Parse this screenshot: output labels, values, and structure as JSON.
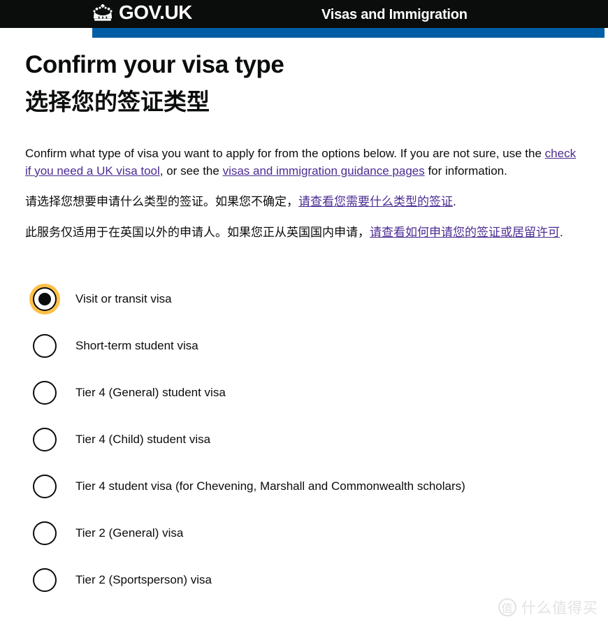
{
  "header": {
    "brand_label": "GOV.UK",
    "crown_icon": "crown-icon",
    "service_name": "Visas and Immigration",
    "background_color": "#0b0c0c",
    "accent_bar_color": "#005ea5"
  },
  "main": {
    "title_en": "Confirm your visa type",
    "title_cn": "选择您的签证类型",
    "paragraph_en": {
      "part1": "Confirm what type of visa you want to apply for from the options below. If you are not sure, use the ",
      "link1": "check if you need a UK visa tool",
      "part2": ", or see the ",
      "link2": "visas and immigration guidance pages",
      "part3": " for information."
    },
    "paragraph_cn_1": {
      "part1": "请选择您想要申请什么类型的签证。如果您不确定，",
      "link1": "请查看您需要什么类型的签证",
      "part2": "."
    },
    "paragraph_cn_2": {
      "part1": "此服务仅适用于在英国以外的申请人。如果您正从英国国内申请，",
      "link1": "请查看如何申请您的签证或居留许可",
      "part2": "."
    },
    "link_color": "#4c2c92"
  },
  "visa_options": [
    {
      "label": "Visit or transit visa",
      "selected": true
    },
    {
      "label": "Short-term student visa",
      "selected": false
    },
    {
      "label": "Tier 4 (General) student visa",
      "selected": false
    },
    {
      "label": "Tier 4 (Child) student visa",
      "selected": false
    },
    {
      "label": "Tier 4 student visa (for Chevening, Marshall and Commonwealth scholars)",
      "selected": false
    },
    {
      "label": "Tier 2 (General) visa",
      "selected": false
    },
    {
      "label": "Tier 2 (Sportsperson) visa",
      "selected": false
    }
  ],
  "focus_ring_color": "#ffbf47",
  "watermark": {
    "badge": "值",
    "text": "什么值得买",
    "color": "#e2e2e4"
  }
}
